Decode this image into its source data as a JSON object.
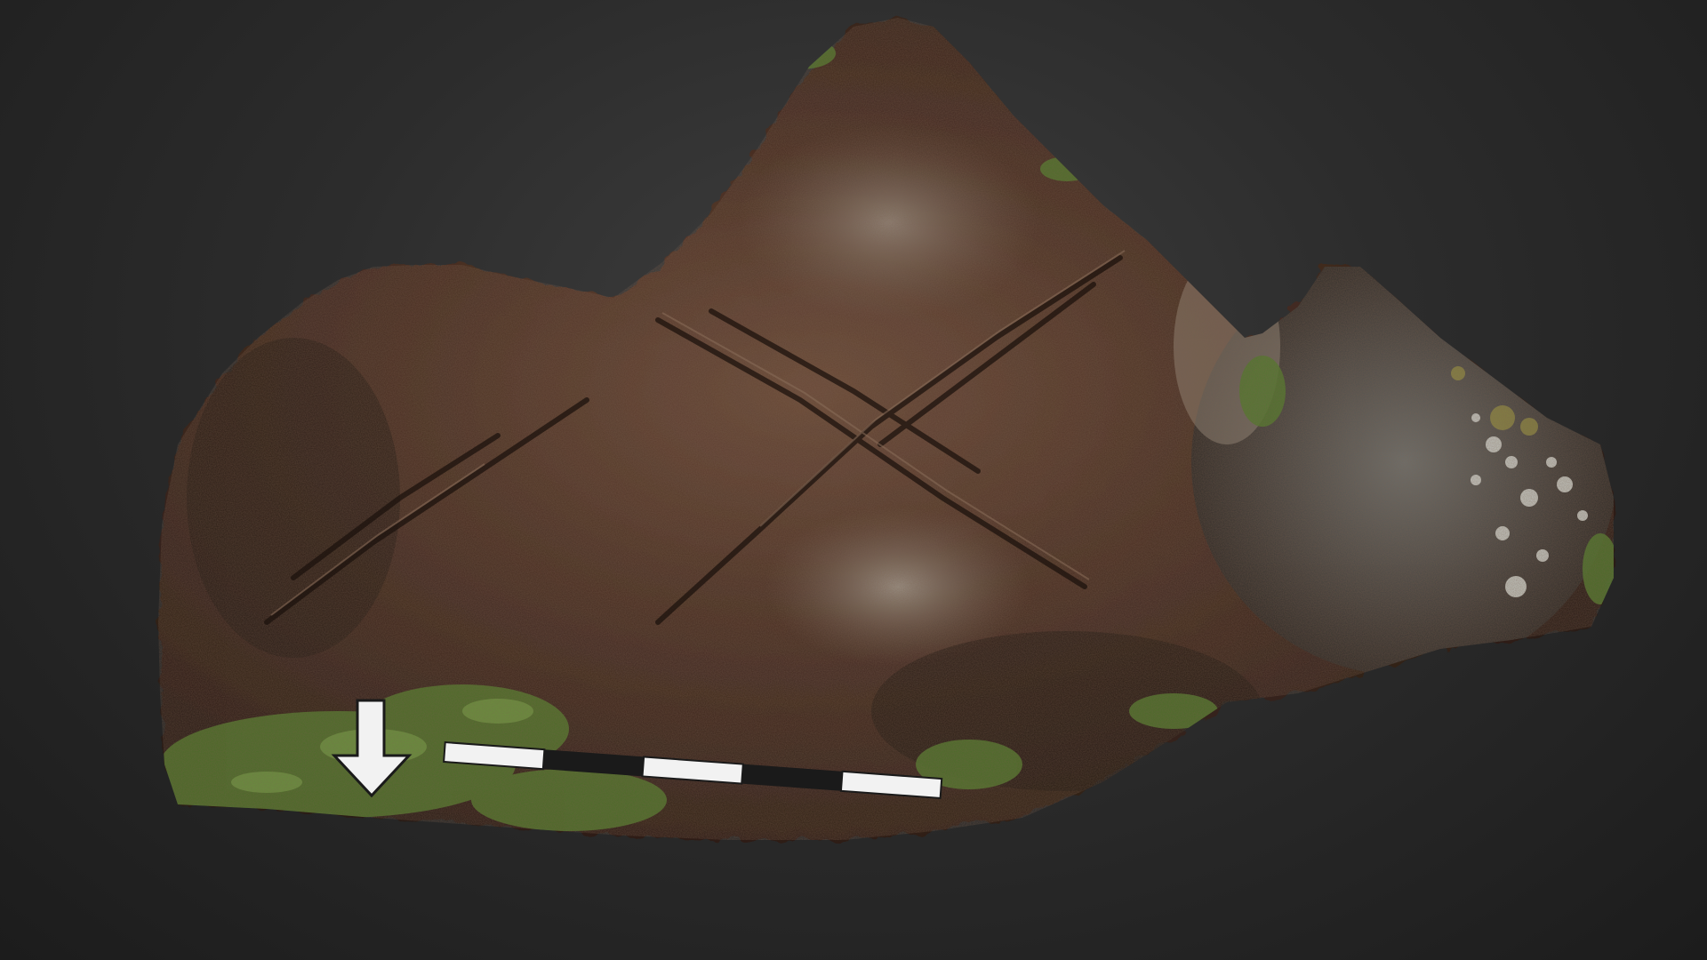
{
  "viewer": {
    "background_color": "#2c2c2c",
    "subject": "3d-model-rock-surface"
  },
  "model": {
    "colors": {
      "rock_main": "#4a3024",
      "rock_dark": "#2a1c15",
      "rock_light": "#8a7566",
      "moss": "#4f7a2a",
      "lichen": "#c9cfc9",
      "scale_white": "#f2f2f2",
      "scale_black": "#1a1a1a"
    },
    "scale_bar": {
      "segments": 4,
      "pattern": [
        "white",
        "black",
        "white",
        "black",
        "white"
      ]
    },
    "north_arrow": {
      "direction": "down"
    }
  }
}
